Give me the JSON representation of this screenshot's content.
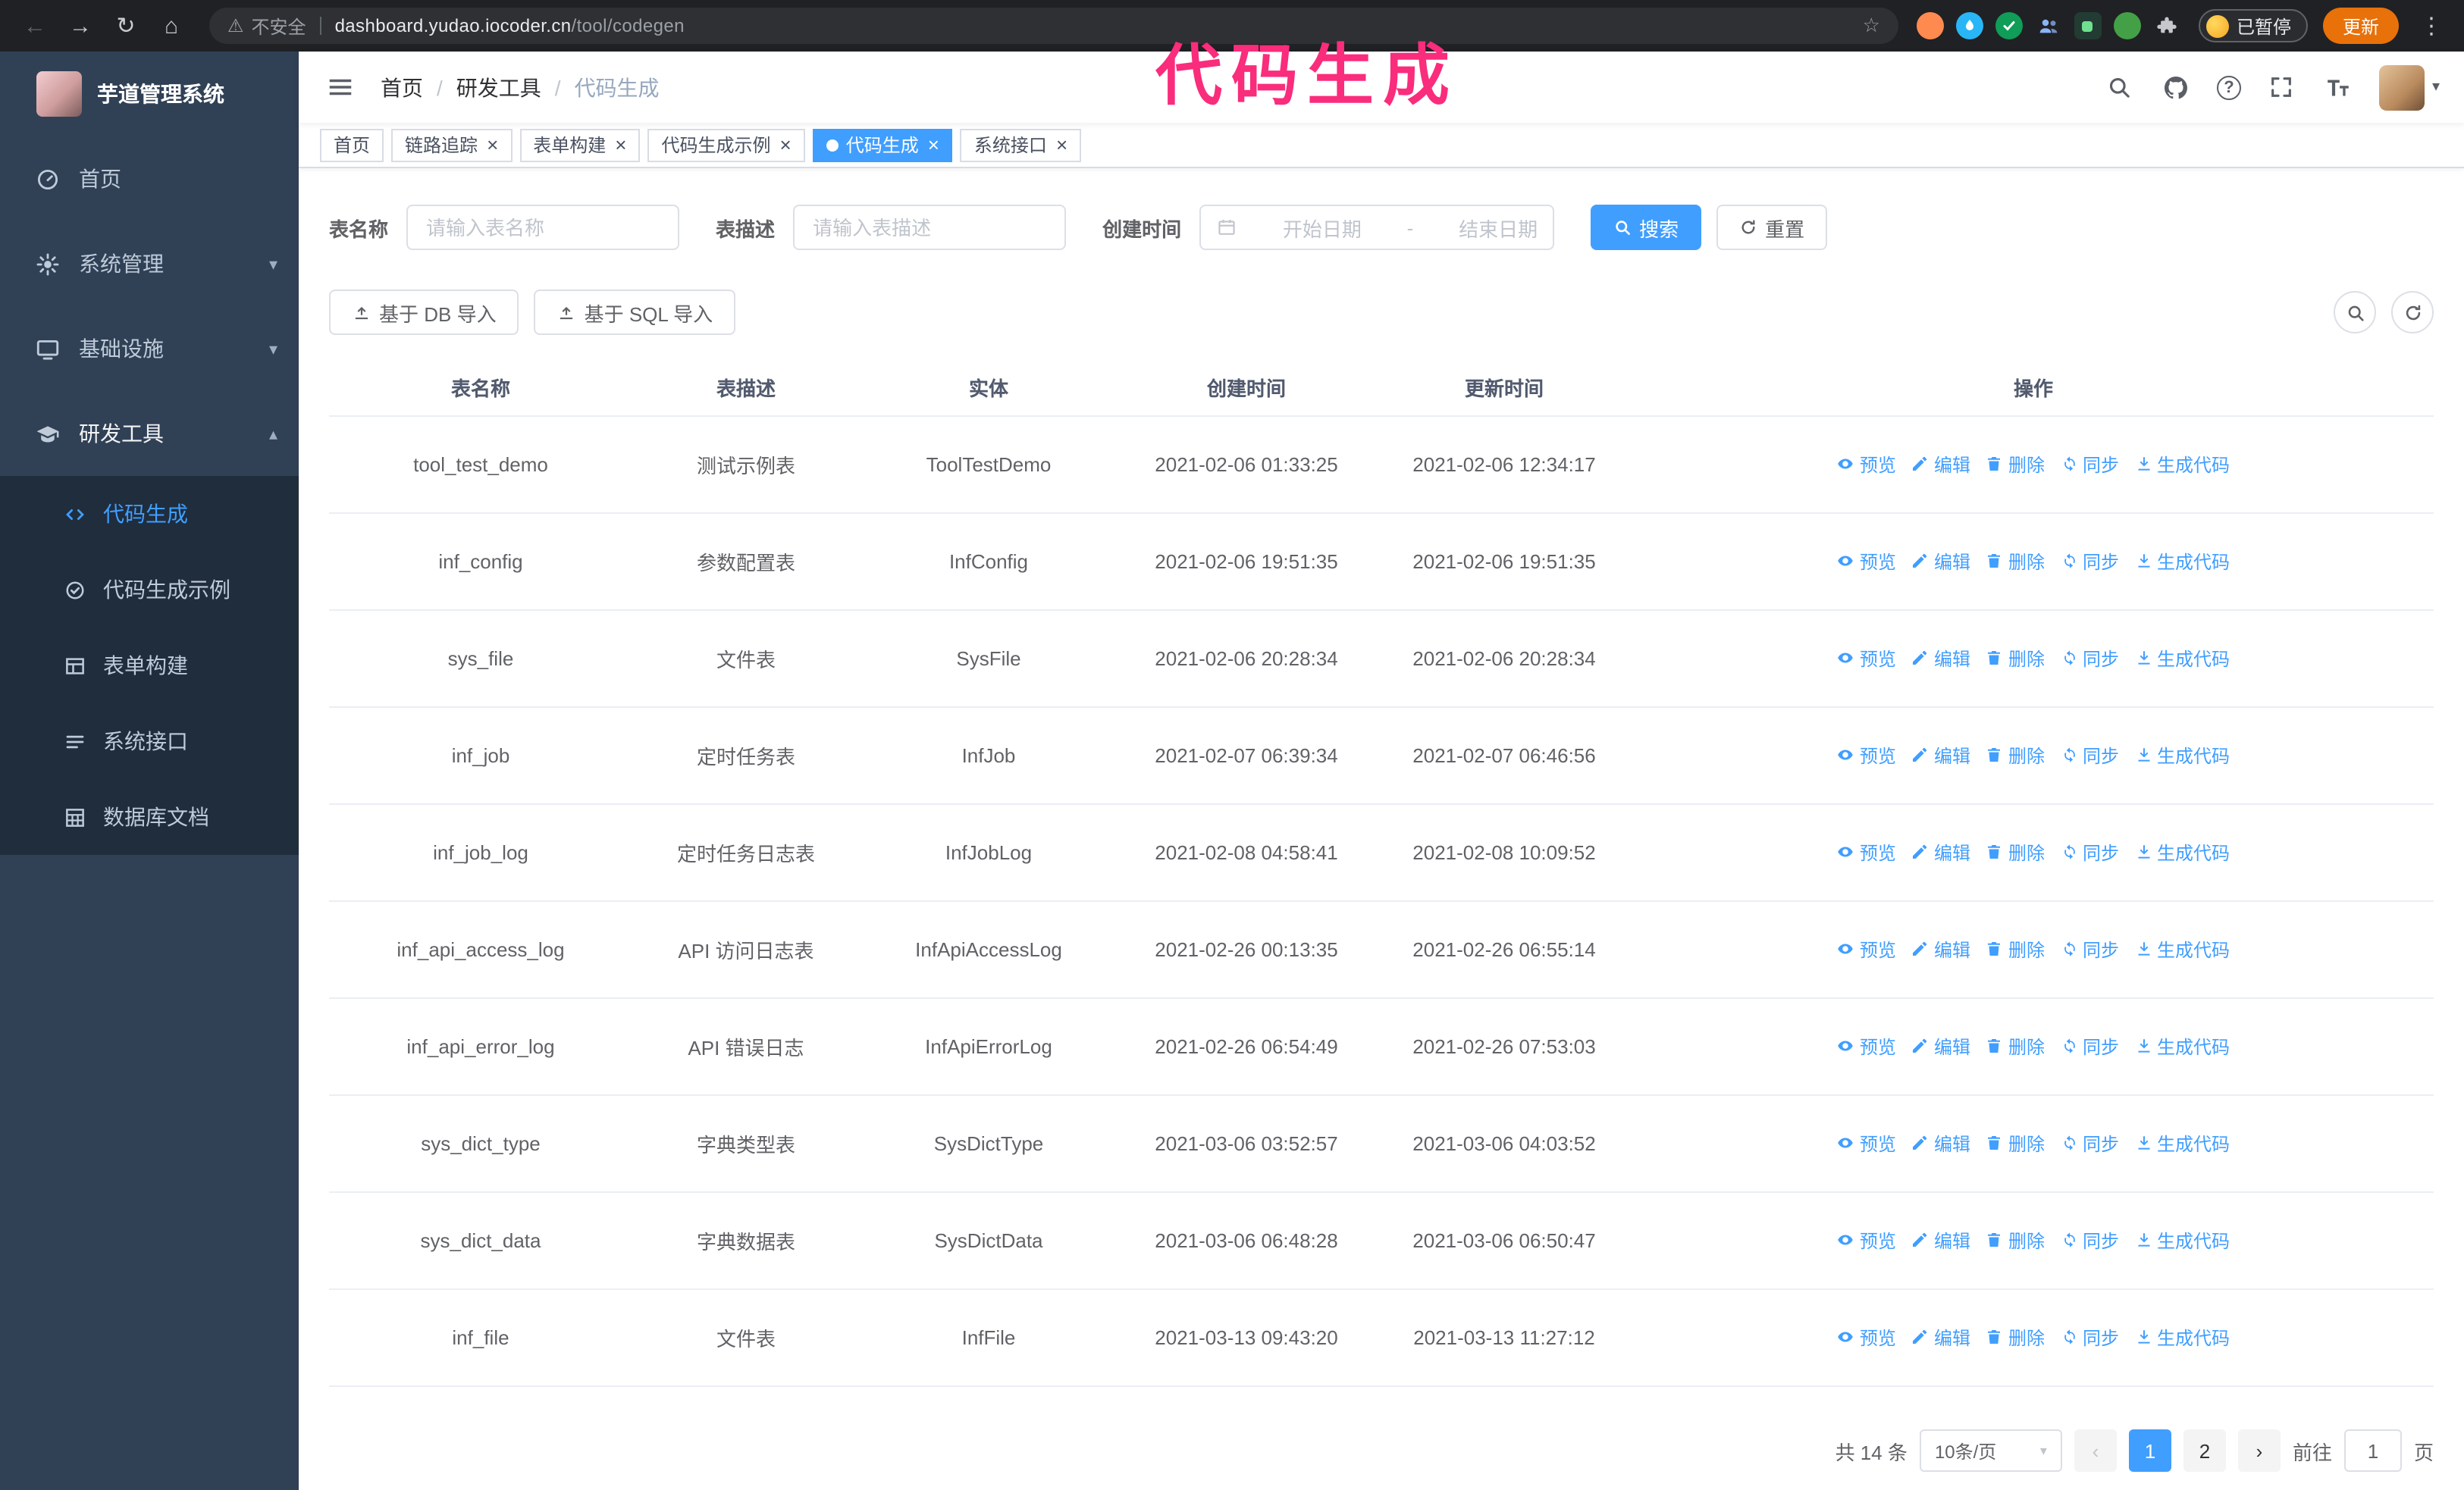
{
  "colors": {
    "primary": "#409eff",
    "annotation_pink": "#fa2c7c",
    "sidebar_bg": "#304156",
    "submenu_bg": "#1f2d3d",
    "update_button": "#e8710a"
  },
  "glyphs": {
    "back": "←",
    "forward": "→",
    "reload": "↻",
    "home": "⌂",
    "warning": "⚠",
    "star": "☆",
    "kebab": "⋮",
    "question": "?",
    "caret_down": "▾",
    "chevron_up": "▴",
    "chevron_down": "▾",
    "close": "×",
    "prev": "‹",
    "next": "›",
    "breadcrumb_sep": "/"
  },
  "browser": {
    "security_label": "不安全",
    "url_host": "dashboard.yudao.iocoder.cn",
    "url_path": "/tool/codegen",
    "paused_badge": "已暂停",
    "update_button": "更新",
    "extensions": [
      {
        "name": "fox-icon",
        "color": "#ff8a50",
        "shape": "circle"
      },
      {
        "name": "drop-icon",
        "color": "#29b6f6",
        "shape": "drop"
      },
      {
        "name": "verified-icon",
        "color": "#0f9d58",
        "shape": "check"
      },
      {
        "name": "people-icon",
        "color": "#8ab4f8",
        "shape": "people"
      },
      {
        "name": "power-icon",
        "color": "#223c33",
        "shape": "square-green"
      },
      {
        "name": "leaf-icon",
        "color": "#43a047",
        "shape": "circle"
      },
      {
        "name": "puzzle-icon",
        "color": "#c4c7cb",
        "shape": "puzzle"
      }
    ]
  },
  "annotation": {
    "text": "代码生成"
  },
  "sidebar": {
    "logo_title": "芋道管理系统",
    "items": [
      {
        "key": "home",
        "icon": "dashboard",
        "label": "首页"
      },
      {
        "key": "system",
        "icon": "gear",
        "label": "系统管理",
        "chevron": "down"
      },
      {
        "key": "infra",
        "icon": "monitor",
        "label": "基础设施",
        "chevron": "down"
      },
      {
        "key": "dev-tools",
        "icon": "education",
        "label": "研发工具",
        "chevron": "up",
        "expanded": true
      }
    ],
    "sub_items": [
      {
        "key": "codegen",
        "icon": "code",
        "label": "代码生成",
        "active": true
      },
      {
        "key": "codegen-example",
        "icon": "badge",
        "label": "代码生成示例"
      },
      {
        "key": "form-builder",
        "icon": "form",
        "label": "表单构建"
      },
      {
        "key": "system-api",
        "icon": "list",
        "label": "系统接口"
      },
      {
        "key": "db-doc",
        "icon": "grid",
        "label": "数据库文档"
      }
    ]
  },
  "header": {
    "breadcrumb": [
      "首页",
      "研发工具",
      "代码生成"
    ]
  },
  "tabs": [
    {
      "label": "首页",
      "closable": false
    },
    {
      "label": "链路追踪",
      "closable": true
    },
    {
      "label": "表单构建",
      "closable": true
    },
    {
      "label": "代码生成示例",
      "closable": true
    },
    {
      "label": "代码生成",
      "closable": true,
      "active": true
    },
    {
      "label": "系统接口",
      "closable": true
    }
  ],
  "filters": {
    "table_name_label": "表名称",
    "table_name_placeholder": "请输入表名称",
    "table_desc_label": "表描述",
    "table_desc_placeholder": "请输入表描述",
    "create_time_label": "创建时间",
    "date_start_placeholder": "开始日期",
    "date_separator": "-",
    "date_end_placeholder": "结束日期",
    "search_button": "搜索",
    "reset_button": "重置"
  },
  "toolbar": {
    "import_db_button": "基于 DB 导入",
    "import_sql_button": "基于 SQL 导入"
  },
  "table": {
    "columns": [
      "表名称",
      "表描述",
      "实体",
      "创建时间",
      "更新时间",
      "操作"
    ],
    "actions": [
      "预览",
      "编辑",
      "删除",
      "同步",
      "生成代码"
    ],
    "rows": [
      {
        "name": "tool_test_demo",
        "desc": "测试示例表",
        "entity": "ToolTestDemo",
        "created": "2021-02-06 01:33:25",
        "updated": "2021-02-06 12:34:17"
      },
      {
        "name": "inf_config",
        "desc": "参数配置表",
        "entity": "InfConfig",
        "created": "2021-02-06 19:51:35",
        "updated": "2021-02-06 19:51:35"
      },
      {
        "name": "sys_file",
        "desc": "文件表",
        "entity": "SysFile",
        "created": "2021-02-06 20:28:34",
        "updated": "2021-02-06 20:28:34"
      },
      {
        "name": "inf_job",
        "desc": "定时任务表",
        "entity": "InfJob",
        "created": "2021-02-07 06:39:34",
        "updated": "2021-02-07 06:46:56"
      },
      {
        "name": "inf_job_log",
        "desc": "定时任务日志表",
        "entity": "InfJobLog",
        "created": "2021-02-08 04:58:41",
        "updated": "2021-02-08 10:09:52"
      },
      {
        "name": "inf_api_access_log",
        "desc": "API 访问日志表",
        "entity": "InfApiAccessLog",
        "created": "2021-02-26 00:13:35",
        "updated": "2021-02-26 06:55:14"
      },
      {
        "name": "inf_api_error_log",
        "desc": "API 错误日志",
        "entity": "InfApiErrorLog",
        "created": "2021-02-26 06:54:49",
        "updated": "2021-02-26 07:53:03"
      },
      {
        "name": "sys_dict_type",
        "desc": "字典类型表",
        "entity": "SysDictType",
        "created": "2021-03-06 03:52:57",
        "updated": "2021-03-06 04:03:52"
      },
      {
        "name": "sys_dict_data",
        "desc": "字典数据表",
        "entity": "SysDictData",
        "created": "2021-03-06 06:48:28",
        "updated": "2021-03-06 06:50:47"
      },
      {
        "name": "inf_file",
        "desc": "文件表",
        "entity": "InfFile",
        "created": "2021-03-13 09:43:20",
        "updated": "2021-03-13 11:27:12"
      }
    ]
  },
  "pagination": {
    "total": "共 14 条",
    "page_size": "10条/页",
    "pages": [
      "1",
      "2"
    ],
    "current": "1",
    "goto_label": "前往",
    "goto_value": "1",
    "goto_suffix": "页"
  }
}
